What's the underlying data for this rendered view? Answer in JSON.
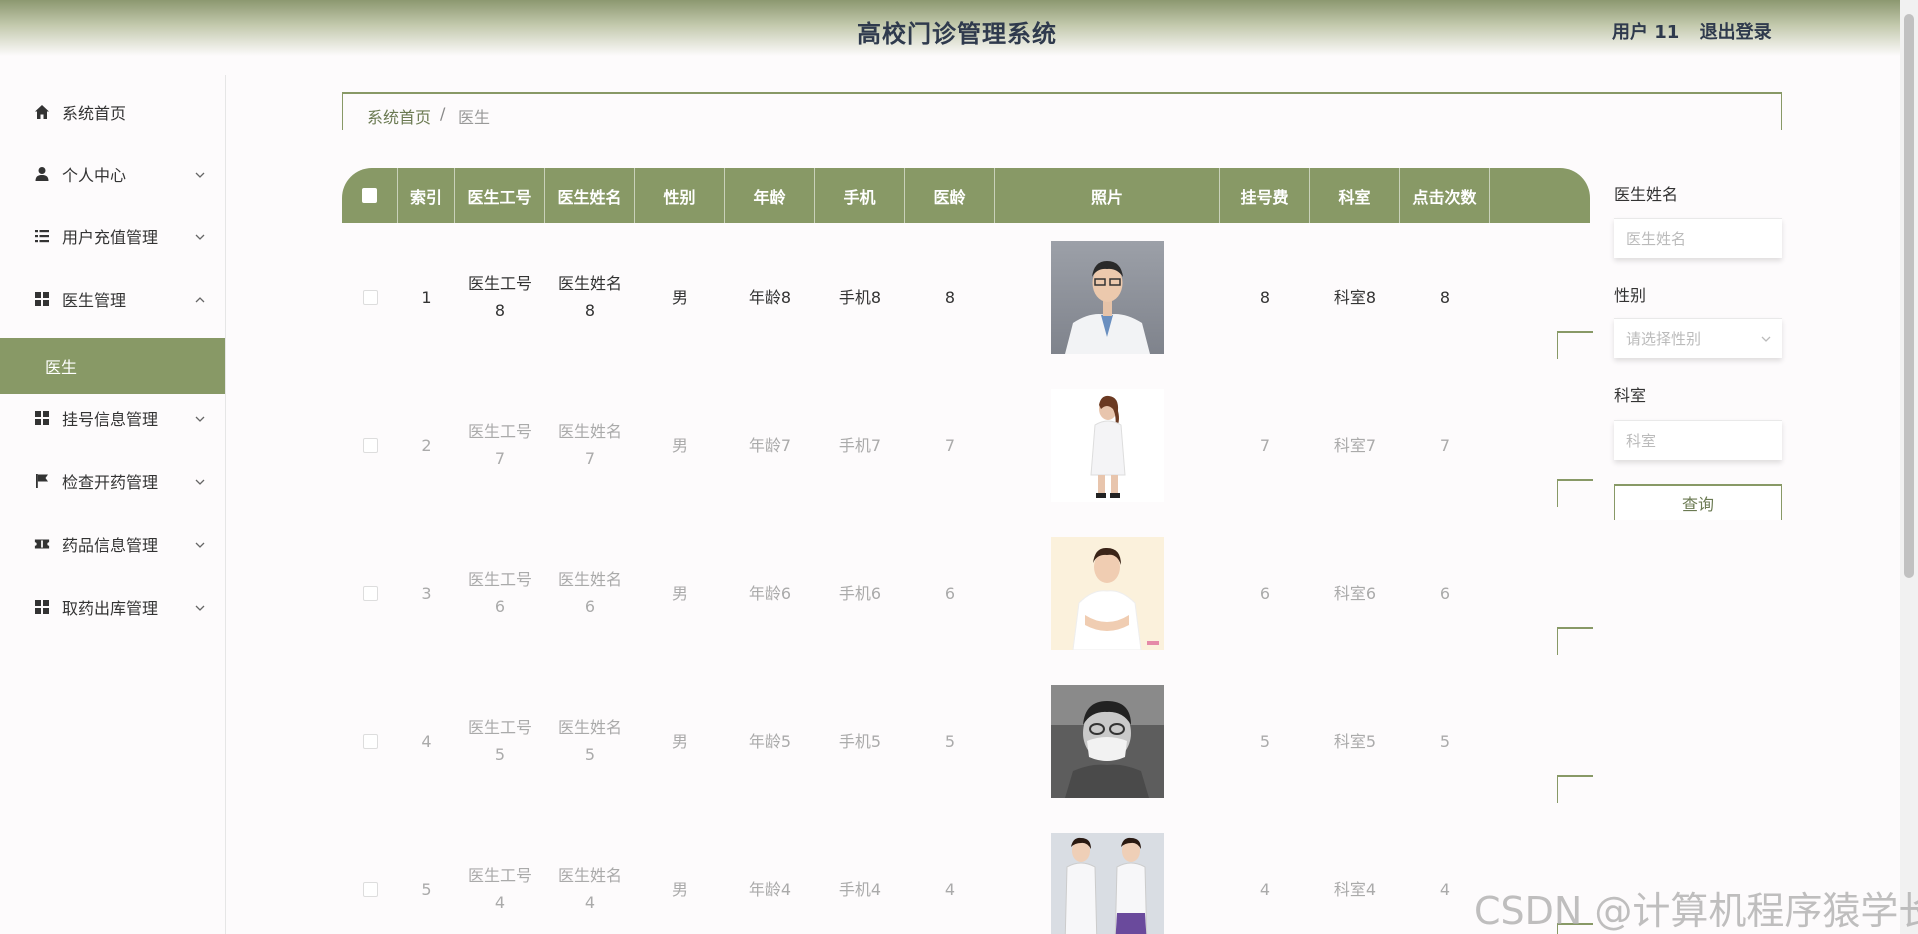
{
  "header": {
    "title": "高校门诊管理系统",
    "user": "用户 11",
    "logout": "退出登录"
  },
  "sidebar": {
    "items": [
      {
        "label": "系统首页",
        "icon": "home-icon"
      },
      {
        "label": "个人中心",
        "icon": "user-icon"
      },
      {
        "label": "用户充值管理",
        "icon": "list-icon"
      },
      {
        "label": "医生管理",
        "icon": "grid-icon"
      },
      {
        "label": "医生",
        "icon": ""
      },
      {
        "label": "挂号信息管理",
        "icon": "grid-icon"
      },
      {
        "label": "检查开药管理",
        "icon": "flag-icon"
      },
      {
        "label": "药品信息管理",
        "icon": "ticket-icon"
      },
      {
        "label": "取药出库管理",
        "icon": "grid-icon"
      }
    ]
  },
  "breadcrumb": {
    "home": "系统首页",
    "sep": "/",
    "current": "医生"
  },
  "table": {
    "columns": [
      "索引",
      "医生工号",
      "医生姓名",
      "性别",
      "年龄",
      "手机",
      "医龄",
      "照片",
      "挂号费",
      "科室",
      "点击次数"
    ],
    "rows": [
      {
        "index": "1",
        "id_line1": "医生工号",
        "id_line2": "8",
        "name_line1": "医生姓名",
        "name_line2": "8",
        "gender": "男",
        "age": "年龄8",
        "phone": "手机8",
        "years": "8",
        "fee": "8",
        "dept": "科室8",
        "clicks": "8"
      },
      {
        "index": "2",
        "id_line1": "医生工号",
        "id_line2": "7",
        "name_line1": "医生姓名",
        "name_line2": "7",
        "gender": "男",
        "age": "年龄7",
        "phone": "手机7",
        "years": "7",
        "fee": "7",
        "dept": "科室7",
        "clicks": "7"
      },
      {
        "index": "3",
        "id_line1": "医生工号",
        "id_line2": "6",
        "name_line1": "医生姓名",
        "name_line2": "6",
        "gender": "男",
        "age": "年龄6",
        "phone": "手机6",
        "years": "6",
        "fee": "6",
        "dept": "科室6",
        "clicks": "6"
      },
      {
        "index": "4",
        "id_line1": "医生工号",
        "id_line2": "5",
        "name_line1": "医生姓名",
        "name_line2": "5",
        "gender": "男",
        "age": "年龄5",
        "phone": "手机5",
        "years": "5",
        "fee": "5",
        "dept": "科室5",
        "clicks": "5"
      },
      {
        "index": "5",
        "id_line1": "医生工号",
        "id_line2": "4",
        "name_line1": "医生姓名",
        "name_line2": "4",
        "gender": "男",
        "age": "年龄4",
        "phone": "手机4",
        "years": "4",
        "fee": "4",
        "dept": "科室4",
        "clicks": "4"
      }
    ]
  },
  "search": {
    "name_label": "医生姓名",
    "name_placeholder": "医生姓名",
    "gender_label": "性别",
    "gender_placeholder": "请选择性别",
    "dept_label": "科室",
    "dept_placeholder": "科室",
    "button": "查询"
  },
  "watermark": "CSDN @计算机程序猿学长",
  "colors": {
    "accent": "#889966",
    "header_dark": "#2f3a4d",
    "background": "#fdfbfc"
  }
}
